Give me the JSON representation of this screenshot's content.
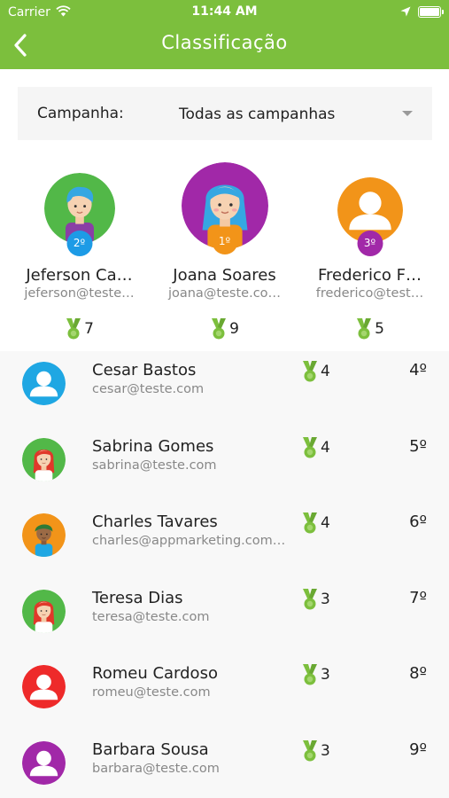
{
  "status": {
    "carrier": "Carrier",
    "time": "11:44 AM"
  },
  "header": {
    "title": "Classificação"
  },
  "filter": {
    "label": "Campanha:",
    "value": "Todas as campanhas"
  },
  "podium": [
    {
      "name": "Jeferson Ca…",
      "email": "jeferson@teste…",
      "points": "7",
      "rank": "2º",
      "avatar": "boy-blue-hair",
      "bg": "#52b848",
      "badge": "#1d9be6"
    },
    {
      "name": "Joana Soares",
      "email": "joana@teste.co…",
      "points": "9",
      "rank": "1º",
      "avatar": "girl-blue-hair",
      "bg": "#a128a8",
      "badge": "#f29419"
    },
    {
      "name": "Frederico F…",
      "email": "frederico@test…",
      "points": "5",
      "rank": "3º",
      "avatar": "user-silhouette",
      "bg": "#f29419",
      "badge": "#a128a8"
    }
  ],
  "ranking": [
    {
      "name": "Cesar Bastos",
      "email": "cesar@teste.com",
      "points": "4",
      "rank": "4º",
      "avatar": "user-silhouette",
      "bg": "#1fa7e3"
    },
    {
      "name": "Sabrina Gomes",
      "email": "sabrina@teste.com",
      "points": "4",
      "rank": "5º",
      "avatar": "girl-red-hair",
      "bg": "#52b848"
    },
    {
      "name": "Charles Tavares",
      "email": "charles@appmarketing.com…",
      "points": "4",
      "rank": "6º",
      "avatar": "boy-green-hair",
      "bg": "#f29419"
    },
    {
      "name": "Teresa Dias",
      "email": "teresa@teste.com",
      "points": "3",
      "rank": "7º",
      "avatar": "girl-red-hair",
      "bg": "#52b848"
    },
    {
      "name": "Romeu Cardoso",
      "email": "romeu@teste.com",
      "points": "3",
      "rank": "8º",
      "avatar": "user-silhouette",
      "bg": "#ee2a2a"
    },
    {
      "name": "Barbara Sousa",
      "email": "barbara@teste.com",
      "points": "3",
      "rank": "9º",
      "avatar": "user-silhouette",
      "bg": "#a128a8"
    }
  ],
  "colors": {
    "header": "#7cbf3d",
    "medal": "#7cbf3d"
  }
}
